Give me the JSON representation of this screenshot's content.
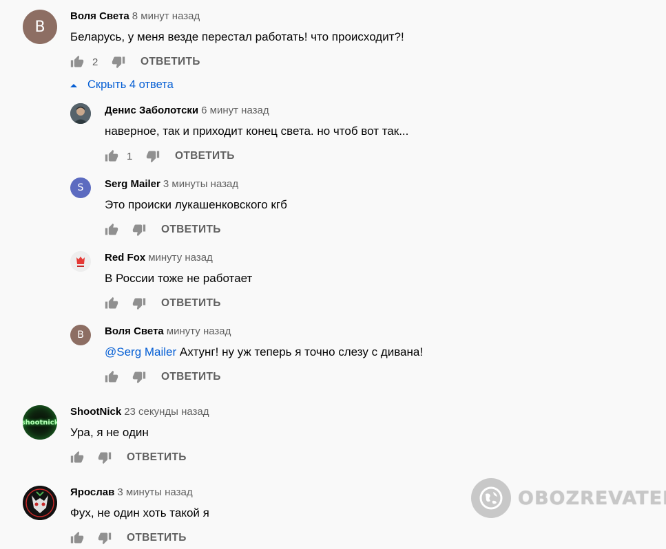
{
  "reply_label": "ОТВЕТИТЬ",
  "toggle_label": "Скрыть 4 ответа",
  "comments": [
    {
      "author": "Воля Света",
      "time": "8 минут назад",
      "text": "Беларусь, у меня везде перестал работать! что происходит?!",
      "likes": "2",
      "avatar_letter": "В",
      "avatar_color": "#8d6e63"
    },
    {
      "author": "Денис Заболотски",
      "time": "6 минут назад",
      "text": "наверное, так и приходит конец света. но чтоб вот так...",
      "likes": "1",
      "avatar_color": "#4a5a63"
    },
    {
      "author": "Serg Mailer",
      "time": "3 минуты назад",
      "text": "Это происки лукашенковского кгб",
      "likes": "",
      "avatar_letter": "S",
      "avatar_color": "#5c6bc0"
    },
    {
      "author": "Red Fox",
      "time": "минуту назад",
      "text": "В России тоже не работает",
      "likes": "",
      "avatar_color": "#eeeeee"
    },
    {
      "author": "Воля Света",
      "time": "минуту назад",
      "mention": "@Serg Mailer",
      "text": "Ахтунг! ну уж теперь я точно слезу с дивана!",
      "likes": "",
      "avatar_letter": "В",
      "avatar_color": "#8d6e63"
    },
    {
      "author": "ShootNick",
      "time": "23 секунды назад",
      "text": "Ура, я не один",
      "likes": "",
      "avatar_label": "shootnick",
      "avatar_color": "#0c1a0c"
    },
    {
      "author": "Ярослав",
      "time": "3 минуты назад",
      "text": "Фух, не один хоть такой я",
      "likes": "",
      "avatar_color": "#121212"
    }
  ],
  "watermark": "OBOZREVATEL"
}
